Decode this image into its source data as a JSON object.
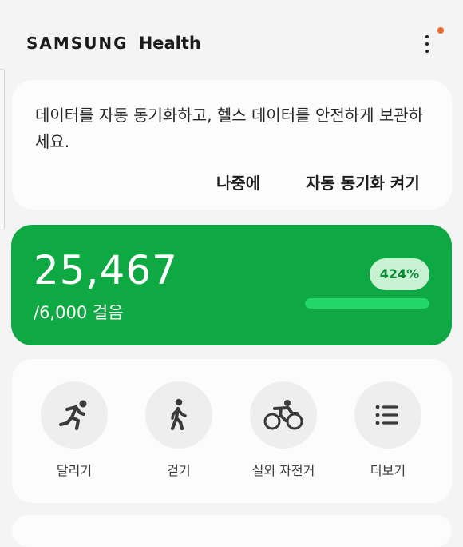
{
  "header": {
    "brand": "SAMSUNG",
    "app_name": "Health",
    "more_icon": "more-vertical-icon",
    "notification_color": "#e66a2c"
  },
  "sync_card": {
    "message": "데이터를 자동 동기화하고, 헬스 데이터를 안전하게 보관하세요.",
    "later_label": "나중에",
    "enable_label": "자동 동기화 켜기"
  },
  "steps": {
    "count": "25,467",
    "goal": "/6,000 걸음",
    "percent_label": "424%",
    "progress": 1.0,
    "accent_color": "#0ea942"
  },
  "activities": [
    {
      "label": "달리기",
      "icon": "running-icon"
    },
    {
      "label": "걷기",
      "icon": "walking-icon"
    },
    {
      "label": "실외 자전거",
      "icon": "cycling-icon"
    },
    {
      "label": "더보기",
      "icon": "list-icon"
    }
  ]
}
